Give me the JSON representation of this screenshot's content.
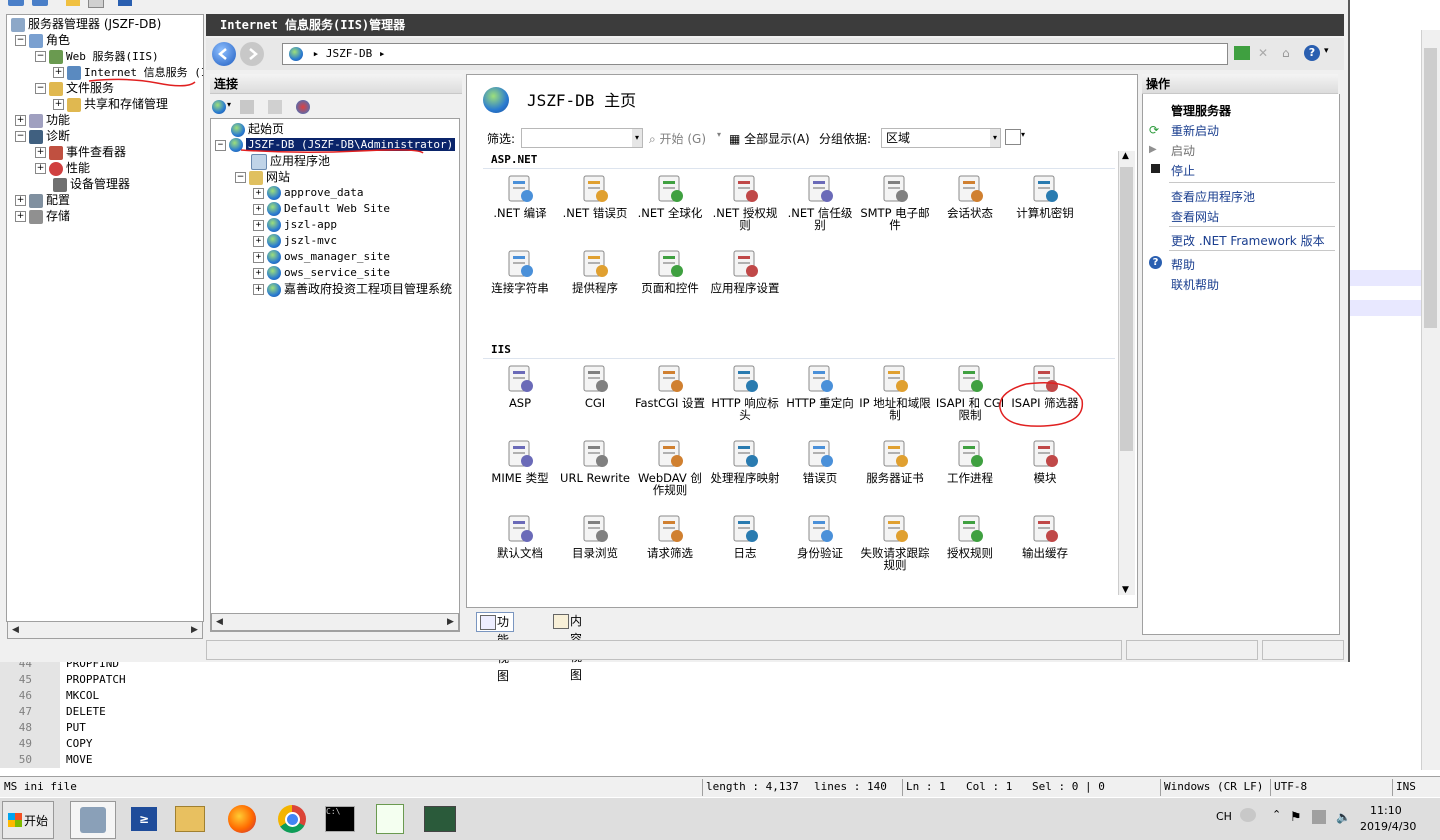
{
  "editor": {
    "lines": [
      {
        "n": "44",
        "text": "PROPFIND"
      },
      {
        "n": "45",
        "text": "PROPPATCH"
      },
      {
        "n": "46",
        "text": "MKCOL"
      },
      {
        "n": "47",
        "text": "DELETE"
      },
      {
        "n": "48",
        "text": "PUT"
      },
      {
        "n": "49",
        "text": "COPY"
      },
      {
        "n": "50",
        "text": "MOVE"
      }
    ],
    "status": {
      "filetype": "MS ini file",
      "length": "length : 4,137",
      "lines": "lines : 140",
      "ln": "Ln : 1",
      "col": "Col : 1",
      "sel": "Sel : 0 | 0",
      "eol": "Windows (CR LF)",
      "encoding": "UTF-8",
      "mode": "INS"
    }
  },
  "server_manager": {
    "tree": [
      {
        "label": "服务器管理器 (JSZF-DB)"
      },
      {
        "label": "角色"
      },
      {
        "label": "Web 服务器(IIS)"
      },
      {
        "label": "Internet 信息服务 (I"
      },
      {
        "label": "文件服务"
      },
      {
        "label": "共享和存储管理"
      },
      {
        "label": "功能"
      },
      {
        "label": "诊断"
      },
      {
        "label": "事件查看器"
      },
      {
        "label": "性能"
      },
      {
        "label": "设备管理器"
      },
      {
        "label": "配置"
      },
      {
        "label": "存储"
      }
    ]
  },
  "iis": {
    "title": "Internet 信息服务(IIS)管理器",
    "address": "JSZF-DB",
    "connections": {
      "header": "连接",
      "tree": [
        {
          "label": "起始页"
        },
        {
          "label": "JSZF-DB (JSZF-DB\\Administrator)"
        },
        {
          "label": "应用程序池"
        },
        {
          "label": "网站"
        },
        {
          "label": "approve_data"
        },
        {
          "label": "Default Web Site"
        },
        {
          "label": "jszl-app"
        },
        {
          "label": "jszl-mvc"
        },
        {
          "label": "ows_manager_site"
        },
        {
          "label": "ows_service_site"
        },
        {
          "label": "嘉善政府投资工程项目管理系统"
        }
      ]
    },
    "home": {
      "title": "JSZF-DB 主页",
      "filter_label": "筛选:",
      "start_label": "开始 (G)",
      "show_all_label": "全部显示(A)",
      "group_label": "分组依据:",
      "group_value": "区域",
      "groups": [
        {
          "name": "ASP.NET",
          "items": [
            ".NET 编译",
            ".NET 错误页",
            ".NET 全球化",
            ".NET 授权规则",
            ".NET 信任级别",
            "SMTP 电子邮件",
            "会话状态",
            "计算机密钥",
            "连接字符串",
            "提供程序",
            "页面和控件",
            "应用程序设置"
          ]
        },
        {
          "name": "IIS",
          "items": [
            "ASP",
            "CGI",
            "FastCGI 设置",
            "HTTP 响应标头",
            "HTTP 重定向",
            "IP 地址和域限制",
            "ISAPI 和 CGI 限制",
            "ISAPI 筛选器",
            "MIME 类型",
            "URL Rewrite",
            "WebDAV 创作规则",
            "处理程序映射",
            "错误页",
            "服务器证书",
            "工作进程",
            "模块",
            "默认文档",
            "目录浏览",
            "请求筛选",
            "日志",
            "身份验证",
            "失败请求跟踪规则",
            "授权规则",
            "输出缓存"
          ]
        }
      ],
      "view_features": "功能视图",
      "view_content": "内容视图"
    },
    "actions": {
      "header": "操作",
      "manage_server": "管理服务器",
      "restart": "重新启动",
      "start": "启动",
      "stop": "停止",
      "view_app_pools": "查看应用程序池",
      "view_sites": "查看网站",
      "change_net": "更改 .NET Framework 版本",
      "help": "帮助",
      "online_help": "联机帮助"
    }
  },
  "taskbar": {
    "start": "开始",
    "lang": "CH",
    "time": "11:10",
    "date": "2019/4/30"
  },
  "colors": {
    "title_bar": "#3c3c3c",
    "selection": "#0a246a",
    "link": "#1a3e8f",
    "annotation": "#e02020"
  }
}
